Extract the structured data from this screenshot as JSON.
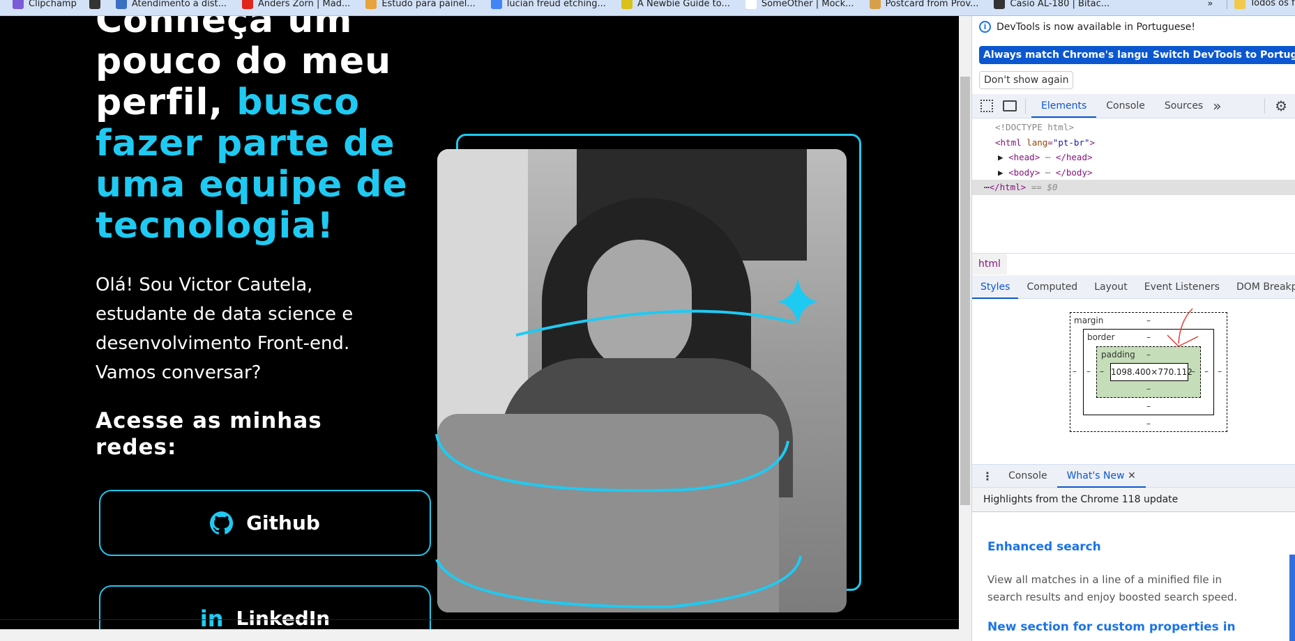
{
  "bookmarks": [
    {
      "label": "Clipchamp",
      "color": "#7b5cd6"
    },
    {
      "label": "",
      "color": "#333333"
    },
    {
      "label": "Atendimento a dist...",
      "color": "#3b6fc2"
    },
    {
      "label": "Anders Zorn | Mad...",
      "color": "#e1261c"
    },
    {
      "label": "Estudo para painel...",
      "color": "#e8a33c"
    },
    {
      "label": "lucian freud etching...",
      "color": "#4285f4"
    },
    {
      "label": "A Newbie Guide to...",
      "color": "#d8c21a"
    },
    {
      "label": "SomeOther | Mock...",
      "color": "#ffffff"
    },
    {
      "label": "Postcard from Prov...",
      "color": "#d6a04a"
    },
    {
      "label": "Casio AL-180 | Bitac...",
      "color": "#333333"
    }
  ],
  "bookmarks_more": "»",
  "bookmarks_folder": "Todos os fa...",
  "page": {
    "heading_white": [
      "Conheça um",
      "pouco do meu",
      "perfil,"
    ],
    "heading_cyan": [
      "busco",
      "fazer parte de",
      "uma equipe de",
      "tecnologia!"
    ],
    "intro": "Olá! Sou Victor Cautela, estudante de data science e desenvolvimento Front-end. Vamos conversar?",
    "socials_title": "Acesse as minhas redes:",
    "github_label": "Github",
    "linkedin_label": "LinkedIn",
    "accent": "#1fcaf2"
  },
  "devtools": {
    "infobar": "DevTools is now available in Portuguese!",
    "btn_match": "Always match Chrome's language",
    "btn_switch": "Switch DevTools to Portuguese",
    "btn_dismiss": "Don't show again",
    "tabs": [
      "Elements",
      "Console",
      "Sources"
    ],
    "more": "»",
    "dom": {
      "doctype": "<!DOCTYPE html>",
      "html_open": "<html",
      "lang_attr": "lang",
      "lang_val": "\"pt-br\"",
      "head": "<head>",
      "head_close": "</head>",
      "body": "<body>",
      "body_close": "</body>",
      "html_close": "</html>",
      "selected": "== $0"
    },
    "breadcrumb": "html",
    "panel_tabs": [
      "Styles",
      "Computed",
      "Layout",
      "Event Listeners",
      "DOM Breakpoints"
    ],
    "box": {
      "margin": "margin",
      "border": "border",
      "padding": "padding",
      "size": "1098.400×770.112",
      "dash": "–"
    },
    "drawer_tabs": [
      "Console",
      "What's New"
    ],
    "highlights": "Highlights from the Chrome 118 update",
    "news": [
      {
        "title": "Enhanced search",
        "body": "View all matches in a line of a minified file in search results and enjoy boosted search speed."
      },
      {
        "title": "New section for custom properties in",
        "body": ""
      }
    ]
  }
}
